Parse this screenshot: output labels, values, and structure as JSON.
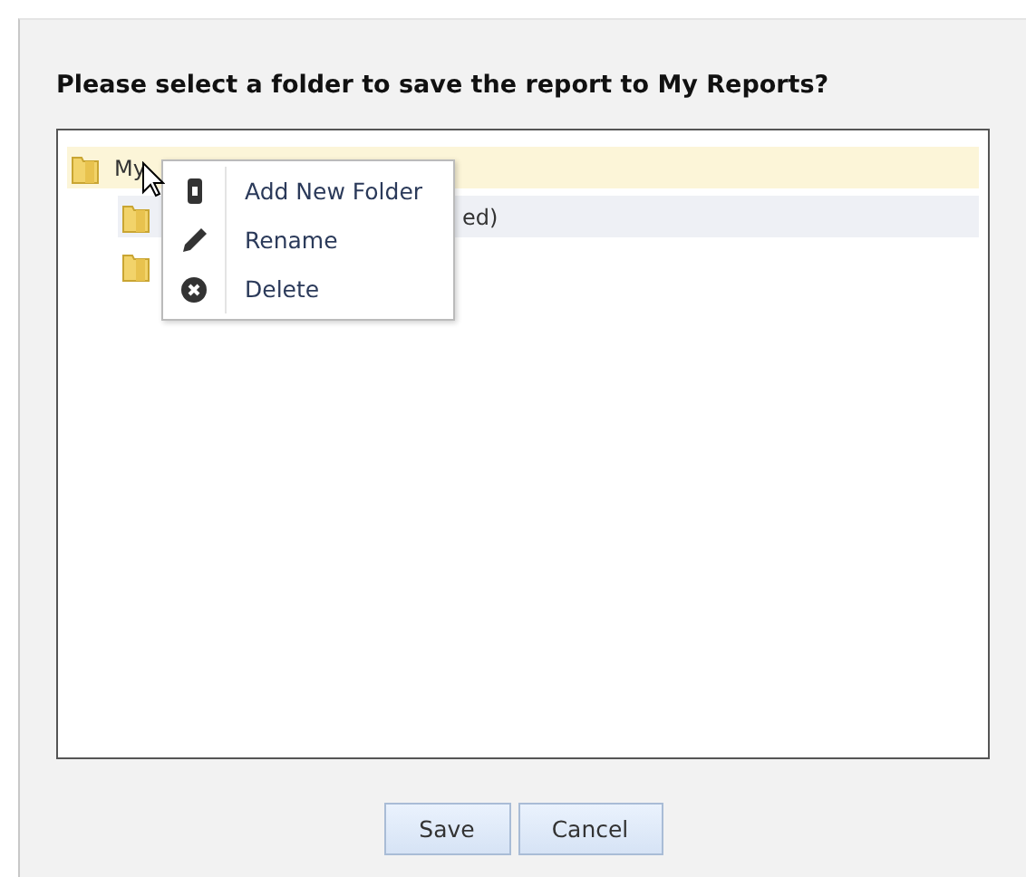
{
  "dialog": {
    "prompt": "Please select a folder to save the report to My Reports?"
  },
  "tree": [
    {
      "label": "My",
      "selected": true,
      "hovered": false,
      "children": [
        {
          "label": "ed)",
          "selected": false,
          "hovered": true
        },
        {
          "selected": false,
          "hovered": false
        }
      ]
    }
  ],
  "context_menu": [
    {
      "kind": "add",
      "label": "Add New Folder"
    },
    {
      "kind": "rename",
      "label": "Rename"
    },
    {
      "kind": "delete",
      "label": "Delete"
    }
  ],
  "buttons": [
    "Save",
    "Cancel"
  ]
}
